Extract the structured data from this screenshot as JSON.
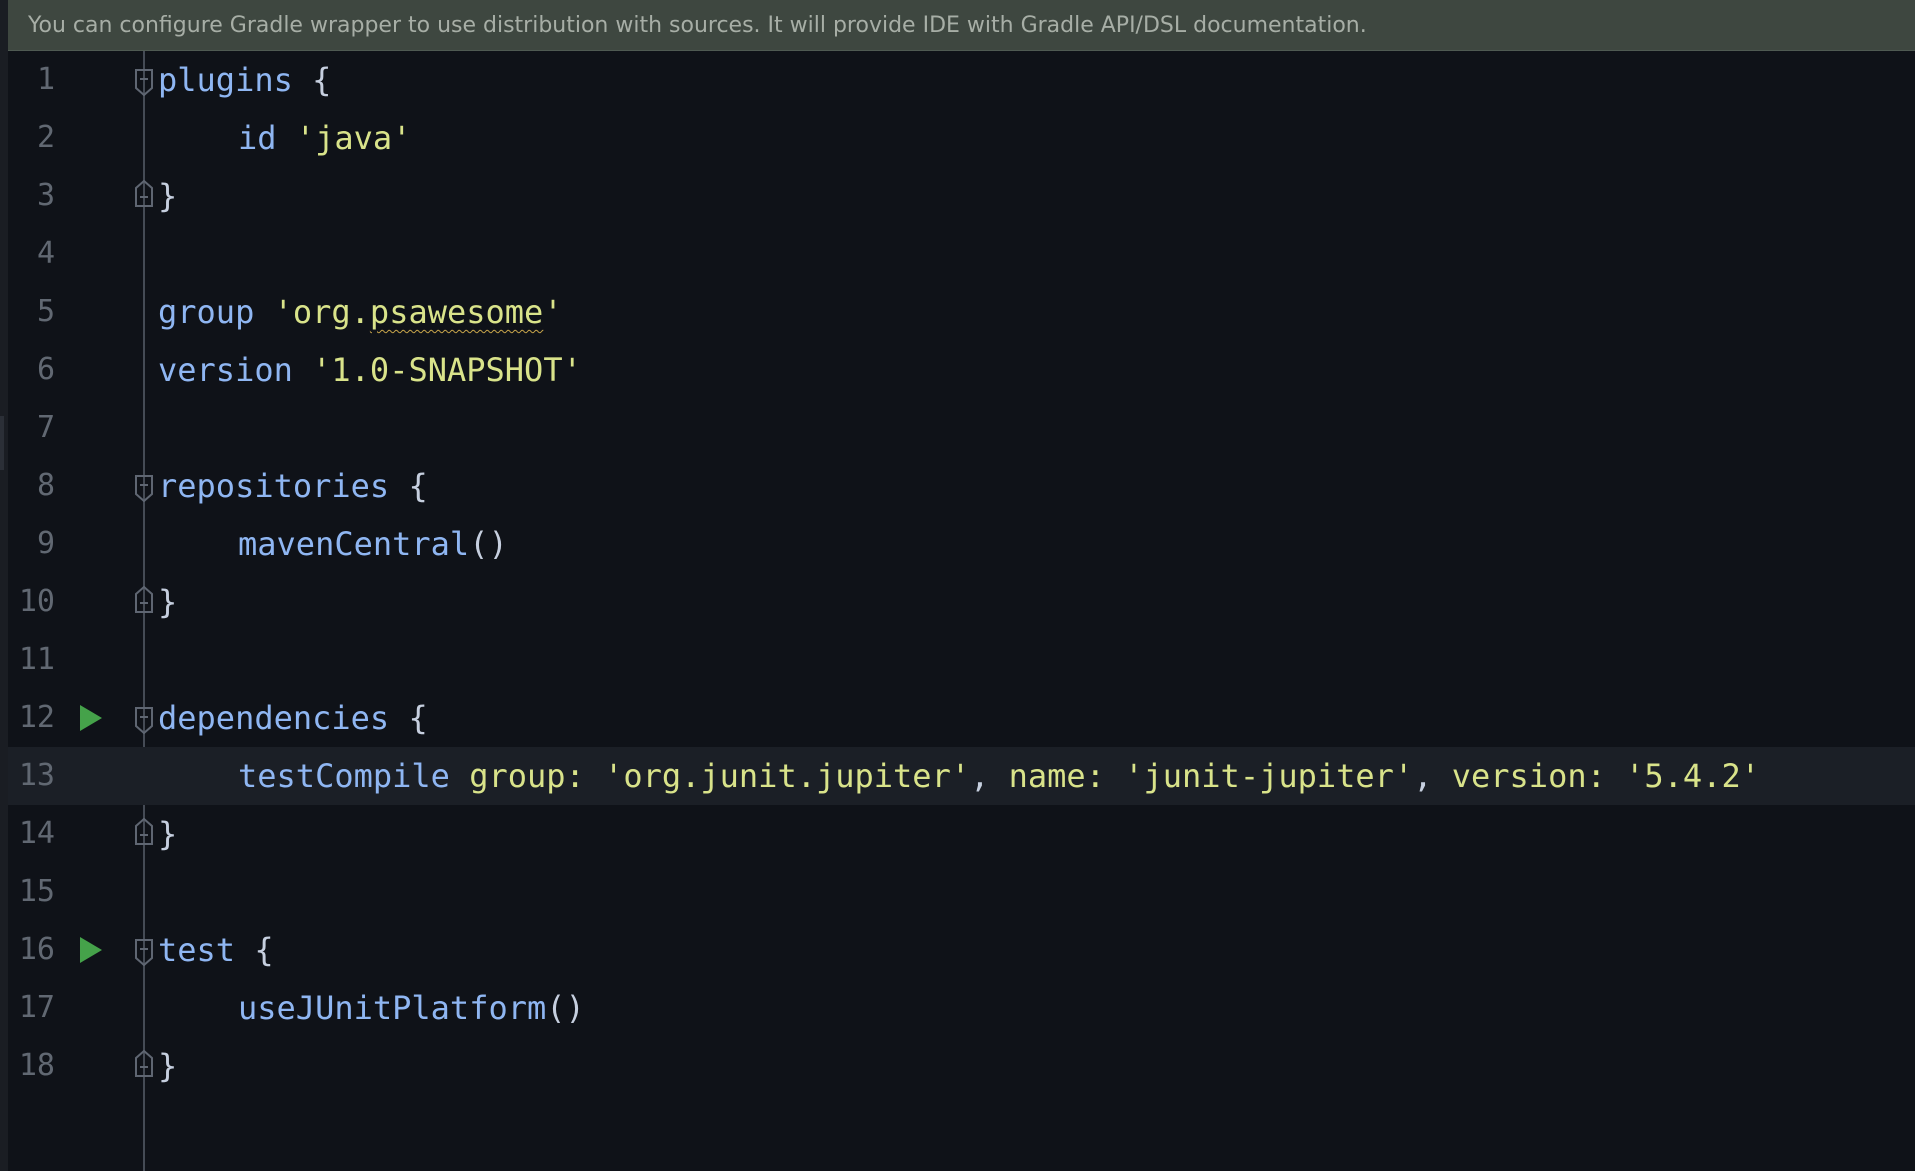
{
  "notification": {
    "text": "You can configure Gradle wrapper to use distribution with sources. It will provide IDE with Gradle API/DSL documentation."
  },
  "colors": {
    "background": "#0f1218",
    "notification_bg": "#3e4740",
    "keyword": "#8fb6f2",
    "string": "#d9e38a",
    "line_number": "#616872",
    "run_gutter": "#45a24a",
    "current_line": "#1b1f26"
  },
  "editor": {
    "current_line": "13",
    "lines": [
      {
        "n": "1",
        "parts": {
          "kw": "plugins",
          "p": " {"
        }
      },
      {
        "n": "2",
        "parts": {
          "kw": "id",
          "sp": " ",
          "str": "'java'"
        }
      },
      {
        "n": "3",
        "parts": {
          "p": "}"
        }
      },
      {
        "n": "4"
      },
      {
        "n": "5",
        "parts": {
          "kw": "group",
          "sp": " ",
          "str_a": "'org.",
          "str_typo": "psawesome",
          "str_b": "'"
        }
      },
      {
        "n": "6",
        "parts": {
          "kw": "version",
          "sp": " ",
          "str": "'1.0-SNAPSHOT'"
        }
      },
      {
        "n": "7"
      },
      {
        "n": "8",
        "parts": {
          "kw": "repositories",
          "p": " {"
        }
      },
      {
        "n": "9",
        "parts": {
          "kw": "mavenCentral",
          "p": "()"
        }
      },
      {
        "n": "10",
        "parts": {
          "p": "}"
        }
      },
      {
        "n": "11"
      },
      {
        "n": "12",
        "parts": {
          "kw": "dependencies",
          "p": " {"
        }
      },
      {
        "n": "13",
        "parts": {
          "kw": "testCompile",
          "sp": " ",
          "k1": "group:",
          "v1": " 'org.junit.jupiter'",
          "c1": ",",
          "k2": " name:",
          "v2": " 'junit-jupiter'",
          "c2": ",",
          "k3": " version:",
          "v3": " '5.4.2'"
        }
      },
      {
        "n": "14",
        "parts": {
          "p": "}"
        }
      },
      {
        "n": "15"
      },
      {
        "n": "16",
        "parts": {
          "kw": "test",
          "p": " {"
        }
      },
      {
        "n": "17",
        "parts": {
          "kw": "useJUnitPlatform",
          "p": "()"
        }
      },
      {
        "n": "18",
        "parts": {
          "p": "}"
        }
      }
    ]
  }
}
